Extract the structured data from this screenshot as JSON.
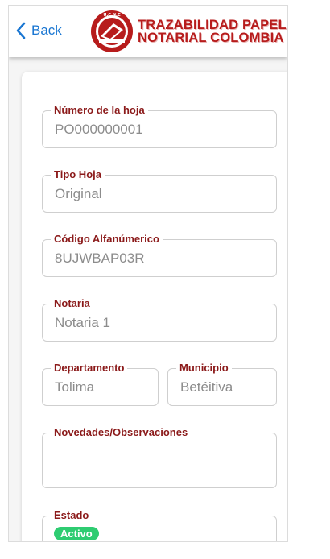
{
  "header": {
    "back_label": "Back",
    "brand_line1": "TRAZABILIDAD PAPEL",
    "brand_line2": "NOTARIAL COLOMBIA",
    "seal_text": "U.C.N.C"
  },
  "form": {
    "numero_hoja": {
      "label": "Número de la hoja",
      "value": "PO000000001"
    },
    "tipo_hoja": {
      "label": "Tipo Hoja",
      "value": "Original"
    },
    "codigo": {
      "label": "Código Alfanúmerico",
      "value": "8UJWBAP03R"
    },
    "notaria": {
      "label": "Notaria",
      "value": "Notaria 1"
    },
    "departamento": {
      "label": "Departamento",
      "value": "Tolima"
    },
    "municipio": {
      "label": "Municipio",
      "value": "Betéitiva"
    },
    "novedades": {
      "label": "Novedades/Observaciones",
      "value": ""
    },
    "estado": {
      "label": "Estado",
      "value": "Activo"
    }
  },
  "colors": {
    "accent": "#8b1a1a",
    "link": "#1976d2",
    "status_active": "#2ecc71"
  }
}
